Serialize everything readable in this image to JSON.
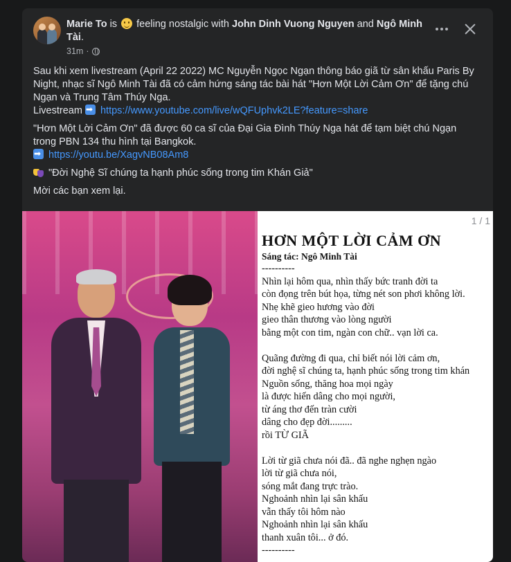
{
  "post": {
    "author": "Marie To",
    "is_text": "is",
    "feeling": "feeling nostalgic with",
    "tag1": "John Dinh Vuong Nguyen",
    "and_text": "and",
    "tag2": "Ngô Minh Tài",
    "period": ".",
    "time": "31m",
    "time_sep": "·",
    "para1": "Sau khi xem livestream (April 22 2022) MC Nguyễn Ngọc Ngạn thông báo giã từ sân khấu Paris By Night, nhạc sĩ Ngô Minh Tài đã có cảm hứng sáng tác bài hát \"Hơn Một Lời Cảm Ơn\" để tặng chú Ngạn và Trung Tâm Thúy Nga.",
    "livestream_label": "Livestream",
    "livestream_url": "https://www.youtube.com/live/wQFUphvk2LE?feature=share",
    "para2": "\"Hơn Một Lời Cảm Ơn\" đã được 60 ca sĩ của Đại Gia Đình Thúy Nga hát để tạm biệt chú Ngạn trong PBN 134 thu hình tại Bangkok.",
    "short_url": "https://youtu.be/XagvNB08Am8",
    "quote": "\"Đời Nghệ Sĩ chúng ta hạnh phúc sống trong tim Khán Giả\"",
    "closing": "Mời các bạn xem lại."
  },
  "icons": {
    "avatar": "avatar-photo",
    "feeling": "smiling-face-icon",
    "privacy": "globe-icon",
    "more": "more-options-icon",
    "close": "close-icon",
    "arrow": "right-arrow-icon",
    "mask": "performing-arts-icon"
  },
  "media": {
    "pager": "1 / 1",
    "lyrics_title": "HƠN MỘT LỜI CẢM ƠN",
    "lyrics_author": "Sáng tác: Ngô Minh Tài",
    "lyrics_lines": [
      "----------",
      "Nhìn lại hôm qua,  nhìn thấy bức tranh đời ta",
      "còn đọng trên bút họa, từng nét son phơi không lời.",
      "Nhẹ khẽ gieo hương vào đời",
      "gieo thân thương vào lòng người",
      "bằng một con tim, ngàn con chữ.. vạn lời ca.",
      "",
      "Quãng đường đi qua, chỉ biết nói lời cảm ơn,",
      "đời nghệ sĩ chúng ta, hạnh phúc sống trong tim khán",
      "Nguồn sống, thăng hoa mọi ngày",
      "là được hiến dâng cho mọi người,",
      "từ áng thơ đến tràn cười",
      "dâng cho đẹp đời.........",
      "rồi TỪ GIÃ",
      "",
      "Lời từ giã chưa nói đã.. đã nghe nghẹn ngào",
      "lời từ giã chưa nói,",
      "sóng mắt đang trực trào.",
      "Nghoảnh nhìn lại sân khấu",
      "vẫn thấy tôi hôm nào",
      "Nghoảnh nhìn lại sân khấu",
      "thanh xuân tôi... ở đó.",
      "----------"
    ]
  },
  "colors": {
    "background": "#18191a",
    "card": "#242526",
    "text": "#e4e6eb",
    "muted": "#b0b3b8",
    "link": "#4599ff"
  }
}
